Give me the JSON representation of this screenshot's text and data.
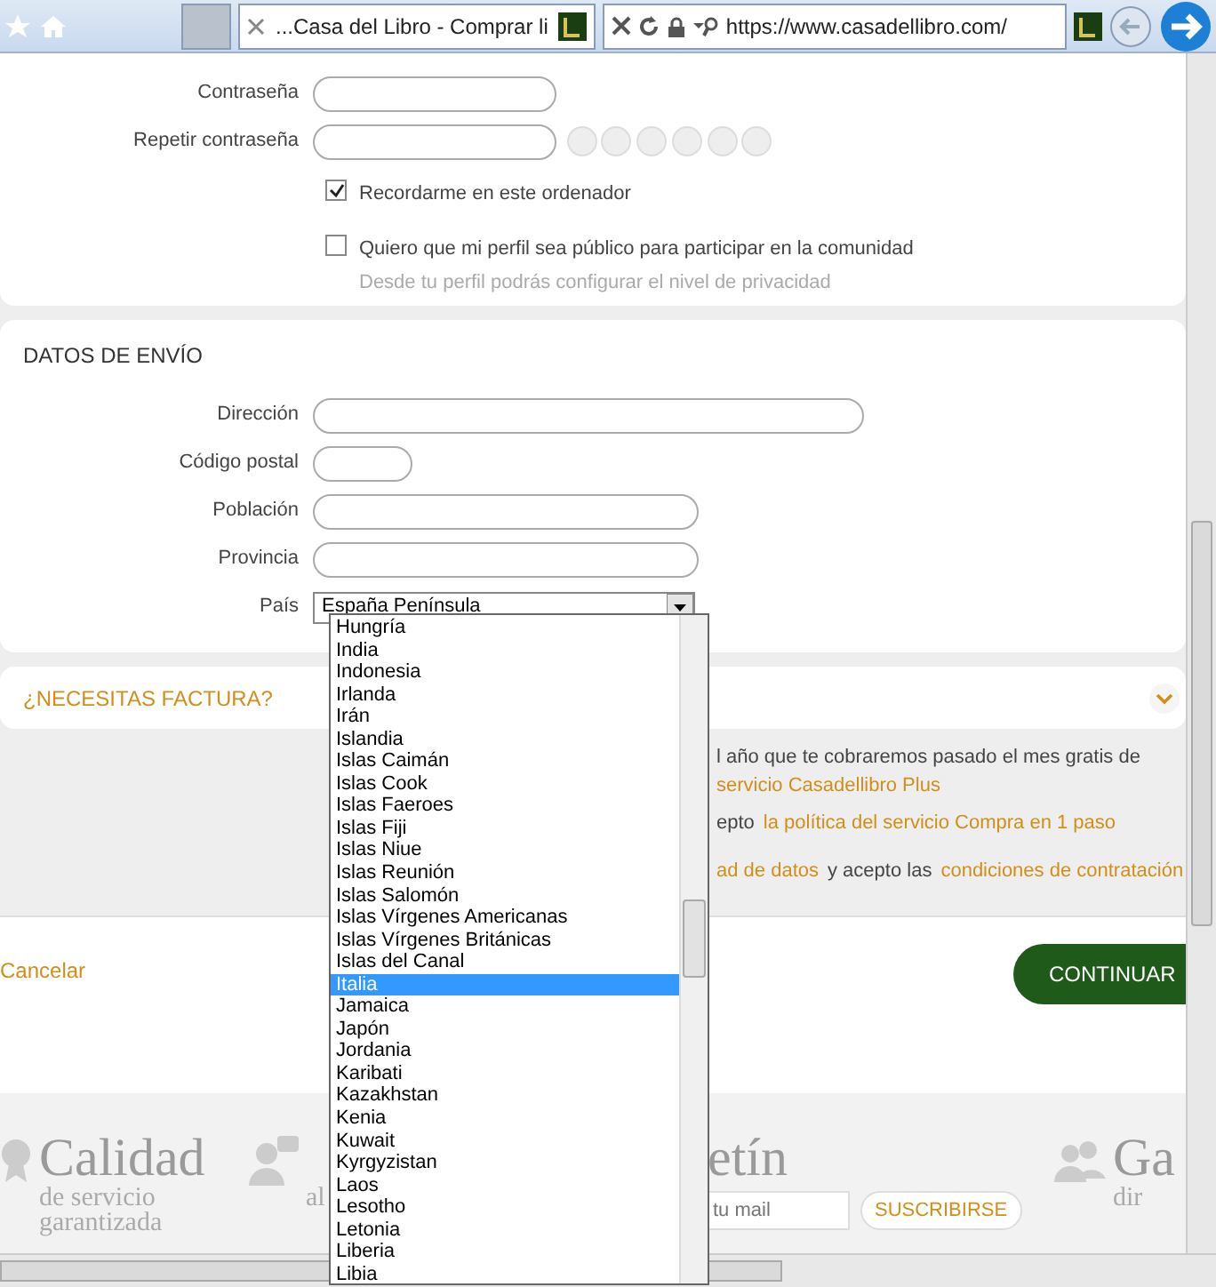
{
  "browser": {
    "tab_title": "...Casa del Libro - Comprar li",
    "url": "https://www.casadellibro.com/"
  },
  "account": {
    "fields": [
      {
        "label": "Contraseña",
        "strength_meter": false
      },
      {
        "label": "Repetir contraseña",
        "strength_meter": true
      }
    ],
    "checks": [
      {
        "label": "Recordarme en este ordenador",
        "checked": true
      },
      {
        "label": "Quiero que mi perfil sea público para participar en la comunidad",
        "hint": "Desde tu perfil podrás configurar el nivel de privacidad",
        "checked": false
      }
    ]
  },
  "shipping": {
    "title": "DATOS DE ENVÍO",
    "fields": [
      {
        "label": "Dirección",
        "kind": "text"
      },
      {
        "label": "Código postal",
        "kind": "text"
      },
      {
        "label": "Población",
        "kind": "text"
      },
      {
        "label": "Provincia",
        "kind": "text"
      },
      {
        "label": "País",
        "kind": "select",
        "value": "España Península"
      }
    ]
  },
  "invoice": {
    "title": "¿NECESITAS FACTURA?",
    "expanded": false
  },
  "terms": [
    {
      "parts": [
        {
          "text": "l año que te cobraremos pasado el mes gratis de",
          "link": false
        }
      ]
    },
    {
      "parts": [
        {
          "text": "servicio Casadellibro Plus",
          "link": true
        }
      ]
    },
    {
      "parts": [
        {
          "text": "epto",
          "link": false
        },
        {
          "text": "la política del servicio Compra en 1 paso",
          "link": true
        }
      ]
    },
    {
      "parts": [
        {
          "text": "ad de datos",
          "link": true
        },
        {
          "text": "y acepto las",
          "link": false
        },
        {
          "text": "condiciones de contratación",
          "link": true
        }
      ]
    }
  ],
  "actions": {
    "cancel": "Cancelar",
    "continue": "CONTINUAR"
  },
  "footer": {
    "blocks": [
      {
        "title": "Calidad",
        "lines": [
          "de servicio",
          "garantizada"
        ]
      },
      {
        "lines": [
          "al"
        ]
      },
      {
        "title": "etín",
        "mail_placeholder": "tu mail",
        "button": "SUSCRIBIRSE"
      },
      {
        "title": "Ga",
        "lines": [
          "dir"
        ]
      }
    ]
  },
  "dropdown": {
    "options": [
      {
        "label": "Hungría",
        "selected": false
      },
      {
        "label": "India",
        "selected": false
      },
      {
        "label": "Indonesia",
        "selected": false
      },
      {
        "label": "Irlanda",
        "selected": false
      },
      {
        "label": "Irán",
        "selected": false
      },
      {
        "label": "Islandia",
        "selected": false
      },
      {
        "label": "Islas Caimán",
        "selected": false
      },
      {
        "label": "Islas Cook",
        "selected": false
      },
      {
        "label": "Islas Faeroes",
        "selected": false
      },
      {
        "label": "Islas Fiji",
        "selected": false
      },
      {
        "label": "Islas Niue",
        "selected": false
      },
      {
        "label": "Islas Reunión",
        "selected": false
      },
      {
        "label": "Islas Salomón",
        "selected": false
      },
      {
        "label": "Islas Vírgenes Americanas",
        "selected": false
      },
      {
        "label": "Islas Vírgenes Británicas",
        "selected": false
      },
      {
        "label": "Islas del Canal",
        "selected": false
      },
      {
        "label": "Italia",
        "selected": true
      },
      {
        "label": "Jamaica",
        "selected": false
      },
      {
        "label": "Japón",
        "selected": false
      },
      {
        "label": "Jordania",
        "selected": false
      },
      {
        "label": "Karibati",
        "selected": false
      },
      {
        "label": "Kazakhstan",
        "selected": false
      },
      {
        "label": "Kenia",
        "selected": false
      },
      {
        "label": "Kuwait",
        "selected": false
      },
      {
        "label": "Kyrgyzistan",
        "selected": false
      },
      {
        "label": "Laos",
        "selected": false
      },
      {
        "label": "Lesotho",
        "selected": false
      },
      {
        "label": "Letonia",
        "selected": false
      },
      {
        "label": "Liberia",
        "selected": false
      },
      {
        "label": "Libia",
        "selected": false
      }
    ]
  }
}
